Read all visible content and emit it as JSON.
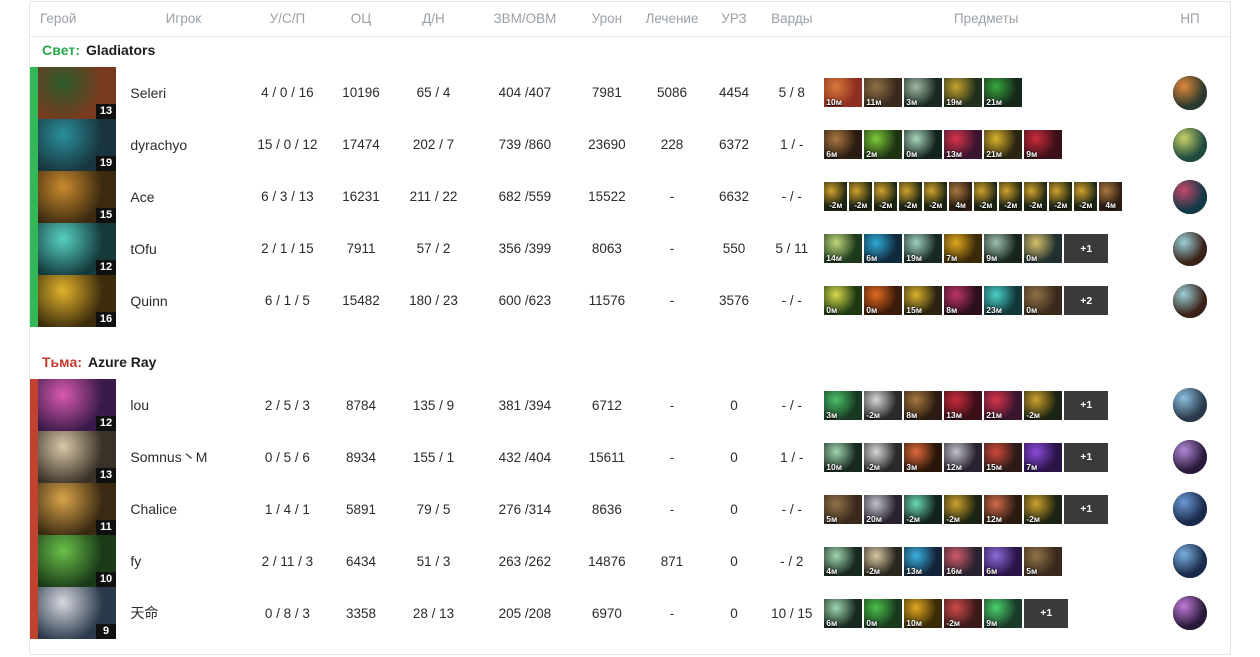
{
  "table": {
    "columns": [
      {
        "key": "hero",
        "label": "Герой"
      },
      {
        "key": "player",
        "label": "Игрок"
      },
      {
        "key": "kda",
        "label": "У/С/П"
      },
      {
        "key": "gold",
        "label": "ОЦ"
      },
      {
        "key": "lhdn",
        "label": "Д/Н"
      },
      {
        "key": "gpmxpm",
        "label": "ЗВМ/ОВМ"
      },
      {
        "key": "damage",
        "label": "Урон"
      },
      {
        "key": "heal",
        "label": "Лечение"
      },
      {
        "key": "dt",
        "label": "УРЗ"
      },
      {
        "key": "wards",
        "label": "Варды"
      },
      {
        "key": "items",
        "label": "Предметы"
      },
      {
        "key": "np",
        "label": "НП"
      }
    ]
  },
  "colors": {
    "radiant": "#2aa64b",
    "dire": "#c0392b",
    "radiant_bar": "#32b857",
    "dire_bar": "#c1432f",
    "header_text": "#9aa0a6",
    "row_text": "#2b2b2b",
    "badge_bg": "#3a3a3a"
  },
  "teams": [
    {
      "side": "radiant",
      "side_label": "Свет:",
      "name": "Gladiators",
      "players": [
        {
          "player": "Seleri",
          "level": "13",
          "kda": "4 / 0 / 16",
          "gold": "10196",
          "lhdn": "65 / 4",
          "gpmxpm": "404 /407",
          "damage": "7981",
          "heal": "5086",
          "dt": "4454",
          "wards": "5 / 8",
          "hero_colors": [
            "#7a3a20",
            "#2c5a2a",
            "#c9743a"
          ],
          "items": [
            {
              "time": "10м",
              "colors": [
                "#8d2f22",
                "#d9793a"
              ]
            },
            {
              "time": "11м",
              "colors": [
                "#3a2a1c",
                "#8f7248"
              ]
            },
            {
              "time": "3м",
              "colors": [
                "#1a2a22",
                "#9fb9a4"
              ]
            },
            {
              "time": "19м",
              "colors": [
                "#20301c",
                "#c6a12c"
              ]
            },
            {
              "time": "21м",
              "colors": [
                "#16281a",
                "#36a83c"
              ]
            }
          ],
          "extra_items": null,
          "np_colors": [
            "#2a3a2e",
            "#e0873a"
          ]
        },
        {
          "player": "dyrachyo",
          "level": "19",
          "kda": "15 / 0 / 12",
          "gold": "17474",
          "lhdn": "202 / 7",
          "gpmxpm": "739 /860",
          "damage": "23690",
          "heal": "228",
          "dt": "6372",
          "wards": "1 / -",
          "hero_colors": [
            "#18343c",
            "#2a8f9c",
            "#b8432c"
          ],
          "items": [
            {
              "time": "6м",
              "colors": [
                "#2a1c12",
                "#a9773f"
              ]
            },
            {
              "time": "2м",
              "colors": [
                "#1d3312",
                "#7ec93a"
              ]
            },
            {
              "time": "0м",
              "colors": [
                "#12231d",
                "#a9d6bb"
              ]
            },
            {
              "time": "13м",
              "colors": [
                "#3a1530",
                "#d8344a"
              ]
            },
            {
              "time": "21м",
              "colors": [
                "#2b2411",
                "#d8b22c"
              ]
            },
            {
              "time": "9м",
              "colors": [
                "#3a0f18",
                "#c92b3c"
              ]
            }
          ],
          "extra_items": null,
          "np_colors": [
            "#1f4a3e",
            "#c7d26a"
          ]
        },
        {
          "player": "Ace",
          "level": "15",
          "kda": "6 / 3 / 13",
          "gold": "16231",
          "lhdn": "211 / 22",
          "gpmxpm": "682 /559",
          "damage": "15522",
          "heal": "-",
          "dt": "6632",
          "wards": "- / -",
          "hero_colors": [
            "#3c2a10",
            "#c98a2e",
            "#7d5a22"
          ],
          "items": [
            {
              "time": "-2м",
              "narrow": true,
              "colors": [
                "#1b2412",
                "#d0a02c"
              ]
            },
            {
              "time": "-2м",
              "narrow": true,
              "colors": [
                "#1b2412",
                "#d0a02c"
              ]
            },
            {
              "time": "-2м",
              "narrow": true,
              "colors": [
                "#1b2412",
                "#d0a02c"
              ]
            },
            {
              "time": "-2м",
              "narrow": true,
              "colors": [
                "#1b2412",
                "#d0a02c"
              ]
            },
            {
              "time": "-2м",
              "narrow": true,
              "colors": [
                "#1b2412",
                "#d0a02c"
              ]
            },
            {
              "time": "4м",
              "narrow": true,
              "colors": [
                "#2a1c12",
                "#a9773f"
              ]
            },
            {
              "time": "-2м",
              "narrow": true,
              "colors": [
                "#1b2412",
                "#d0a02c"
              ]
            },
            {
              "time": "-2м",
              "narrow": true,
              "colors": [
                "#1b2412",
                "#d0a02c"
              ]
            },
            {
              "time": "-2м",
              "narrow": true,
              "colors": [
                "#1b2412",
                "#d0a02c"
              ]
            },
            {
              "time": "-2м",
              "narrow": true,
              "colors": [
                "#1b2412",
                "#d0a02c"
              ]
            },
            {
              "time": "-2м",
              "narrow": true,
              "colors": [
                "#1b2412",
                "#d0a02c"
              ]
            },
            {
              "time": "4м",
              "narrow": true,
              "colors": [
                "#2a1c12",
                "#a9773f"
              ]
            }
          ],
          "extra_items": null,
          "np_colors": [
            "#123a46",
            "#c3476a"
          ]
        },
        {
          "player": "tOfu",
          "level": "12",
          "kda": "2 / 1 / 15",
          "gold": "7911",
          "lhdn": "57 / 2",
          "gpmxpm": "356 /399",
          "damage": "8063",
          "heal": "-",
          "dt": "550",
          "wards": "5 / 11",
          "hero_colors": [
            "#143a3c",
            "#57d0c0",
            "#d44a6a"
          ],
          "items": [
            {
              "time": "14м",
              "colors": [
                "#1d3a1c",
                "#bfd57a"
              ]
            },
            {
              "time": "6м",
              "colors": [
                "#0f2a3c",
                "#2fa8d8"
              ]
            },
            {
              "time": "19м",
              "colors": [
                "#16281f",
                "#9fcfc0"
              ]
            },
            {
              "time": "7м",
              "colors": [
                "#3a2a08",
                "#e0a820"
              ]
            },
            {
              "time": "9м",
              "colors": [
                "#17241c",
                "#9dbfae"
              ]
            },
            {
              "time": "0м",
              "colors": [
                "#203030",
                "#d9c06a"
              ]
            }
          ],
          "extra_items": "+1",
          "np_colors": [
            "#3a2218",
            "#9ad0d8"
          ]
        },
        {
          "player": "Quinn",
          "level": "16",
          "kda": "6 / 1 / 5",
          "gold": "15482",
          "lhdn": "180 / 23",
          "gpmxpm": "600 /623",
          "damage": "11576",
          "heal": "-",
          "dt": "3576",
          "wards": "- / -",
          "hero_colors": [
            "#3c2c0c",
            "#e0b32c",
            "#2b7a4c"
          ],
          "items": [
            {
              "time": "0м",
              "colors": [
                "#1d3a12",
                "#d6d84a"
              ]
            },
            {
              "time": "0м",
              "colors": [
                "#3a1a08",
                "#e06a22"
              ]
            },
            {
              "time": "15м",
              "colors": [
                "#2b2411",
                "#d8b22c"
              ]
            },
            {
              "time": "8м",
              "colors": [
                "#2a0f1c",
                "#c0346a"
              ]
            },
            {
              "time": "23м",
              "colors": [
                "#12383a",
                "#4ad0c8"
              ]
            },
            {
              "time": "0м",
              "colors": [
                "#3a2a1c",
                "#8f7248"
              ]
            }
          ],
          "extra_items": "+2",
          "np_colors": [
            "#3a2218",
            "#9ad0d8"
          ]
        }
      ]
    },
    {
      "side": "dire",
      "side_label": "Тьма:",
      "name": "Azure Ray",
      "players": [
        {
          "player": "lou",
          "level": "12",
          "kda": "2 / 5 / 3",
          "gold": "8784",
          "lhdn": "135 / 9",
          "gpmxpm": "381 /394",
          "damage": "6712",
          "heal": "-",
          "dt": "0",
          "wards": "- / -",
          "hero_colors": [
            "#3a1a4a",
            "#d85ab0",
            "#1c4a6a"
          ],
          "items": [
            {
              "time": "3м",
              "colors": [
                "#183a22",
                "#4ac06a"
              ]
            },
            {
              "time": "-2м",
              "colors": [
                "#2a2a2c",
                "#d8d8da"
              ]
            },
            {
              "time": "8м",
              "colors": [
                "#2a1c12",
                "#a9773f"
              ]
            },
            {
              "time": "13м",
              "colors": [
                "#3a0f18",
                "#c92b3c"
              ]
            },
            {
              "time": "21м",
              "colors": [
                "#3a1530",
                "#d8344a"
              ]
            },
            {
              "time": "-2м",
              "colors": [
                "#1b2412",
                "#d0a02c"
              ]
            }
          ],
          "extra_items": "+1",
          "np_colors": [
            "#2a3a4a",
            "#8ac0e0"
          ]
        },
        {
          "player": "Somnus丶M",
          "level": "13",
          "kda": "0 / 5 / 6",
          "gold": "8934",
          "lhdn": "155 / 1",
          "gpmxpm": "432 /404",
          "damage": "15611",
          "heal": "-",
          "dt": "0",
          "wards": "1 / -",
          "hero_colors": [
            "#3a3228",
            "#d8c8a8",
            "#6a7a8c"
          ],
          "items": [
            {
              "time": "10м",
              "colors": [
                "#17281f",
                "#9fd6b0"
              ]
            },
            {
              "time": "-2м",
              "colors": [
                "#2a2a2c",
                "#d8d8da"
              ]
            },
            {
              "time": "3м",
              "colors": [
                "#2a1608",
                "#e06a3a"
              ]
            },
            {
              "time": "12м",
              "colors": [
                "#2a2230",
                "#c0c0c8"
              ]
            },
            {
              "time": "15м",
              "colors": [
                "#2a1a18",
                "#d04a3a"
              ]
            },
            {
              "time": "7м",
              "colors": [
                "#2a1448",
                "#8a4ad8"
              ]
            }
          ],
          "extra_items": "+1",
          "np_colors": [
            "#2a1a3a",
            "#b08ad8"
          ]
        },
        {
          "player": "Chalice",
          "level": "11",
          "kda": "1 / 4 / 1",
          "gold": "5891",
          "lhdn": "79 / 5",
          "gpmxpm": "276 /314",
          "damage": "8636",
          "heal": "-",
          "dt": "0",
          "wards": "- / -",
          "hero_colors": [
            "#3a2a12",
            "#d8a44a",
            "#2a4a6a"
          ],
          "items": [
            {
              "time": "5м",
              "colors": [
                "#3a2a1c",
                "#8f7248"
              ]
            },
            {
              "time": "20м",
              "colors": [
                "#2a2230",
                "#c0c0c8"
              ]
            },
            {
              "time": "-2м",
              "colors": [
                "#12231d",
                "#6ad8b0"
              ]
            },
            {
              "time": "-2м",
              "colors": [
                "#1b2412",
                "#d0a02c"
              ]
            },
            {
              "time": "12м",
              "colors": [
                "#2a1a10",
                "#d06a4a"
              ]
            },
            {
              "time": "-2м",
              "colors": [
                "#1b2412",
                "#d0a02c"
              ]
            }
          ],
          "extra_items": "+1",
          "np_colors": [
            "#1a2a4a",
            "#6a9ad8"
          ]
        },
        {
          "player": "fy",
          "level": "10",
          "kda": "2 / 11 / 3",
          "gold": "6434",
          "lhdn": "51 / 3",
          "gpmxpm": "263 /262",
          "damage": "14876",
          "heal": "871",
          "dt": "0",
          "wards": "- / 2",
          "hero_colors": [
            "#1a3a18",
            "#6ac04a",
            "#2a8a7a"
          ],
          "items": [
            {
              "time": "4м",
              "colors": [
                "#17281f",
                "#9fd6b0"
              ]
            },
            {
              "time": "-2м",
              "colors": [
                "#2a2620",
                "#d8c8a0"
              ]
            },
            {
              "time": "13м",
              "colors": [
                "#12243a",
                "#3ab0e0"
              ]
            },
            {
              "time": "16м",
              "colors": [
                "#2a2230",
                "#d05a6a"
              ]
            },
            {
              "time": "6м",
              "colors": [
                "#2a1448",
                "#8a6ad8"
              ]
            },
            {
              "time": "5м",
              "colors": [
                "#3a2a1c",
                "#8f7248"
              ]
            }
          ],
          "extra_items": null,
          "np_colors": [
            "#1a2a4a",
            "#7ab0e0"
          ]
        },
        {
          "player": "天命",
          "level": "9",
          "kda": "0 / 8 / 3",
          "gold": "3358",
          "lhdn": "28 / 13",
          "gpmxpm": "205 /208",
          "damage": "6970",
          "heal": "-",
          "dt": "0",
          "wards": "10 / 15",
          "hero_colors": [
            "#2a3a4a",
            "#d8d8e0",
            "#e0c03a"
          ],
          "items": [
            {
              "time": "6м",
              "colors": [
                "#17281f",
                "#9fd6b0"
              ]
            },
            {
              "time": "0м",
              "colors": [
                "#1a3a1c",
                "#4ac04a"
              ]
            },
            {
              "time": "10м",
              "colors": [
                "#3a2a08",
                "#e0a820"
              ]
            },
            {
              "time": "-2м",
              "colors": [
                "#3a1a1a",
                "#d04a4a"
              ]
            },
            {
              "time": "9м",
              "colors": [
                "#1a3a2a",
                "#4ad06a"
              ]
            }
          ],
          "extra_items": "+1",
          "np_colors": [
            "#2a1a3a",
            "#c07ad8"
          ]
        }
      ]
    }
  ]
}
